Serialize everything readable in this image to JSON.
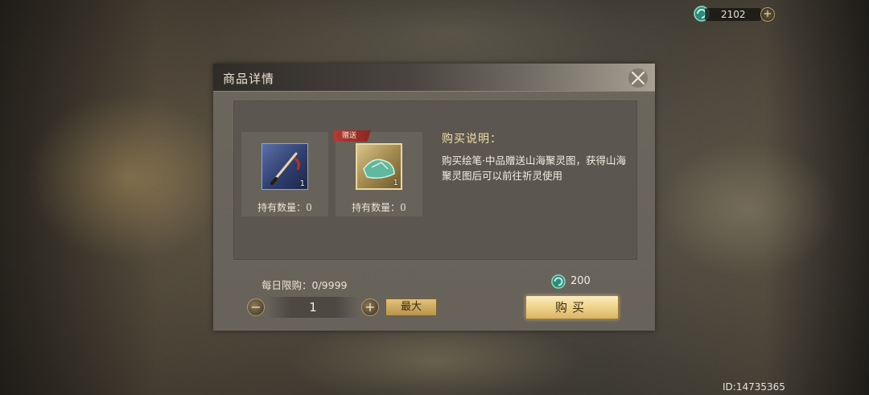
{
  "currency": {
    "icon": "jade-coin-icon",
    "value": "2102"
  },
  "dialog": {
    "title": "商品详情",
    "items": [
      {
        "icon": "brush-icon",
        "count": "1",
        "hold_label": "持有数量：0"
      },
      {
        "icon": "scroll-map-icon",
        "count": "1",
        "hold_label": "持有数量：0",
        "tag": "赠送"
      }
    ],
    "description": {
      "title": "购买说明：",
      "text": "购买绘笔·中品赠送山海聚灵图，获得山海聚灵图后可以前往祈灵使用"
    },
    "daily_limit_label": "每日限购：",
    "daily_limit_value": "0/9999",
    "quantity": "1",
    "max_label": "最大",
    "price": "200",
    "buy_label": "购买"
  },
  "player_id": "ID:14735365"
}
